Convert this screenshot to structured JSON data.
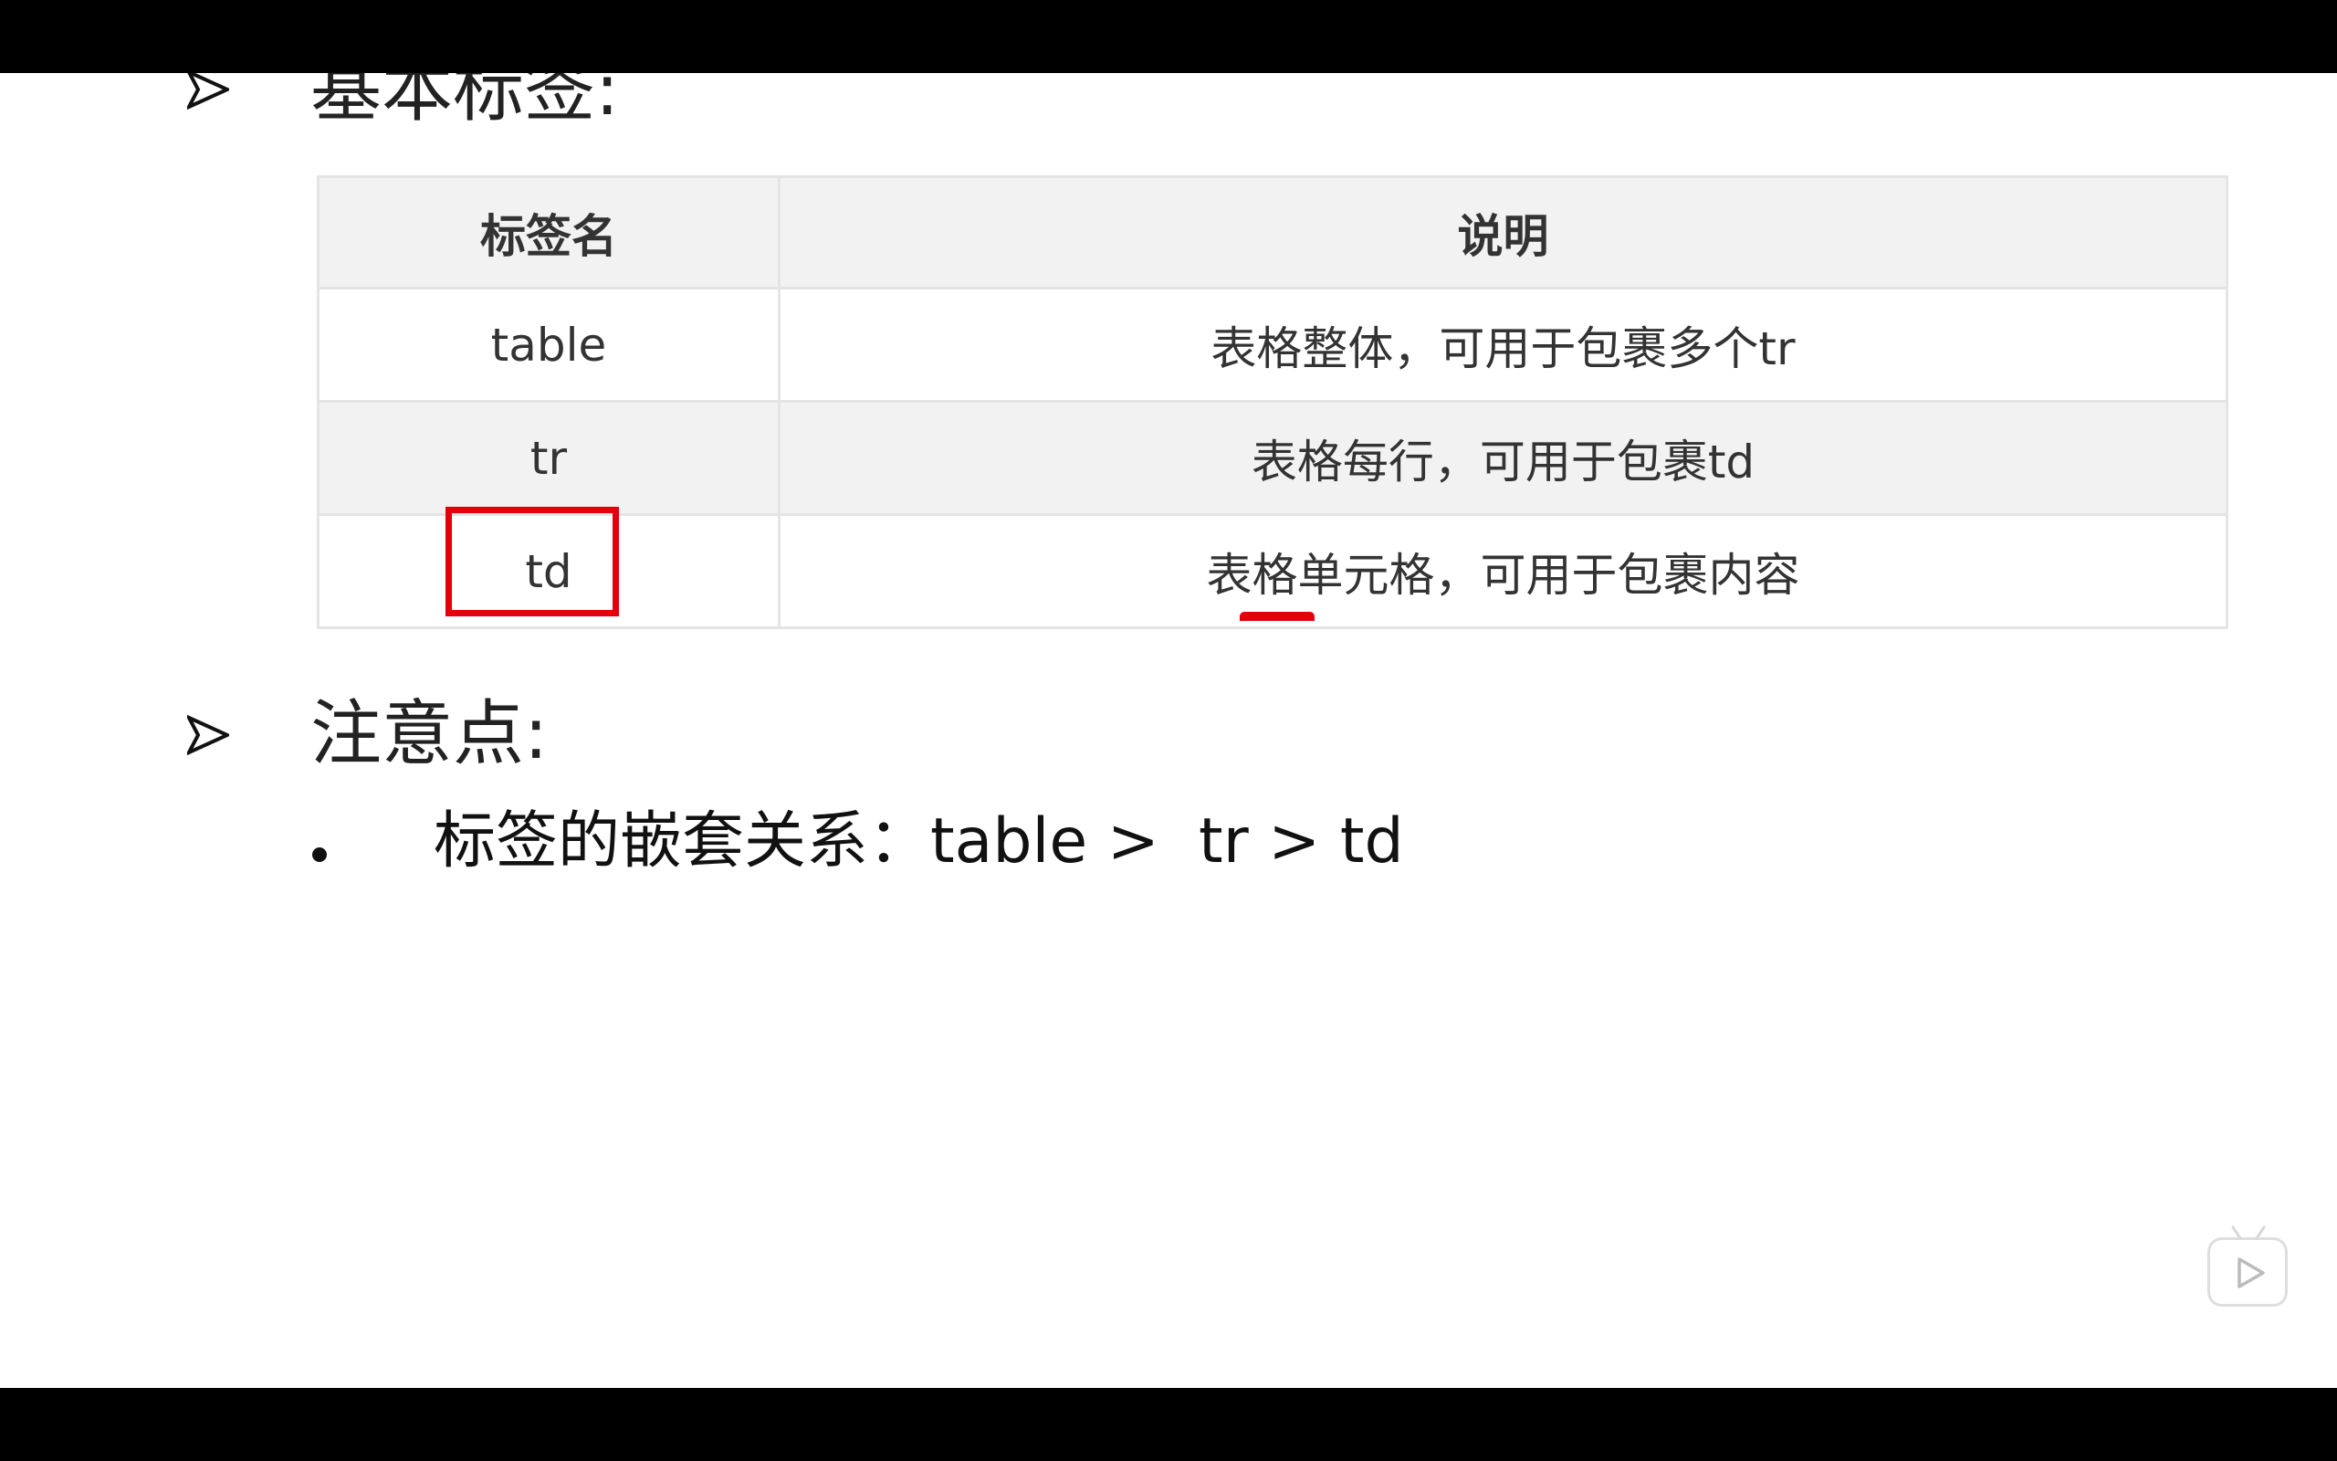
{
  "slide": {
    "watermark_text": "bilibili",
    "heading_basic": "基本标签:",
    "table": {
      "headers": [
        "标签名",
        "说明"
      ],
      "rows": [
        {
          "tag": "table",
          "desc": "表格整体，可用于包裹多个tr"
        },
        {
          "tag": "tr",
          "desc": "表格每行，可用于包裹td"
        },
        {
          "tag": "td",
          "desc": "表格单元格，可用于包裹内容"
        }
      ]
    },
    "heading_notes": "注意点:",
    "bullet_text": "标签的嵌套关系：table >  tr > td"
  },
  "player": {
    "play_icon": "play-icon",
    "accent_color": "#e3000b"
  }
}
